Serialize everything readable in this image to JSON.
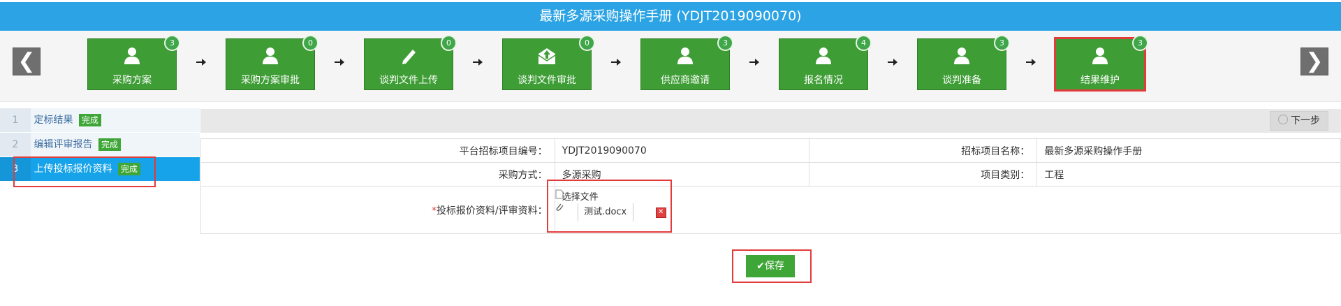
{
  "page": {
    "title": "最新多源采购操作手册 (YDJT2019090070)"
  },
  "nav": {
    "prev_icon": "chevron-left-icon",
    "next_icon": "chevron-right-icon",
    "prev_glyph": "❮",
    "next_glyph": "❯"
  },
  "steps": [
    {
      "label": "采购方案",
      "count": "3",
      "icon": "user-icon"
    },
    {
      "label": "采购方案审批",
      "count": "0",
      "icon": "user-icon"
    },
    {
      "label": "谈判文件上传",
      "count": "0",
      "icon": "pencil-icon"
    },
    {
      "label": "谈判文件审批",
      "count": "0",
      "icon": "upload-mail-icon"
    },
    {
      "label": "供应商邀请",
      "count": "3",
      "icon": "user-icon"
    },
    {
      "label": "报名情况",
      "count": "4",
      "icon": "user-icon"
    },
    {
      "label": "谈判准备",
      "count": "3",
      "icon": "user-icon"
    },
    {
      "label": "结果维护",
      "count": "3",
      "icon": "user-icon",
      "active": true
    }
  ],
  "menu": [
    {
      "num": "1",
      "label": "定标结果",
      "tag": "完成"
    },
    {
      "num": "2",
      "label": "编辑评审报告",
      "tag": "完成"
    },
    {
      "num": "3",
      "label": "上传投标报价资料",
      "tag": "完成",
      "selected": true
    }
  ],
  "toolbar": {
    "next_label": "下一步"
  },
  "form": {
    "platform_no_label": "平台招标项目编号：",
    "platform_no_value": "YDJT2019090070",
    "project_name_label": "招标项目名称：",
    "project_name_value": "最新多源采购操作手册",
    "method_label": "采购方式：",
    "method_value": "多源采购",
    "category_label": "项目类别：",
    "category_value": "工程",
    "upload_label_required": "*",
    "upload_label": "投标报价资料/评审资料：",
    "choose_file": "选择文件",
    "file_name": "测试.docx"
  },
  "actions": {
    "save_label": "保存"
  },
  "colors": {
    "title_bar": "#2ba3e4",
    "step_green": "#3e9d35",
    "highlight_red": "#e23b3b",
    "menu_selected": "#16a3e9"
  }
}
